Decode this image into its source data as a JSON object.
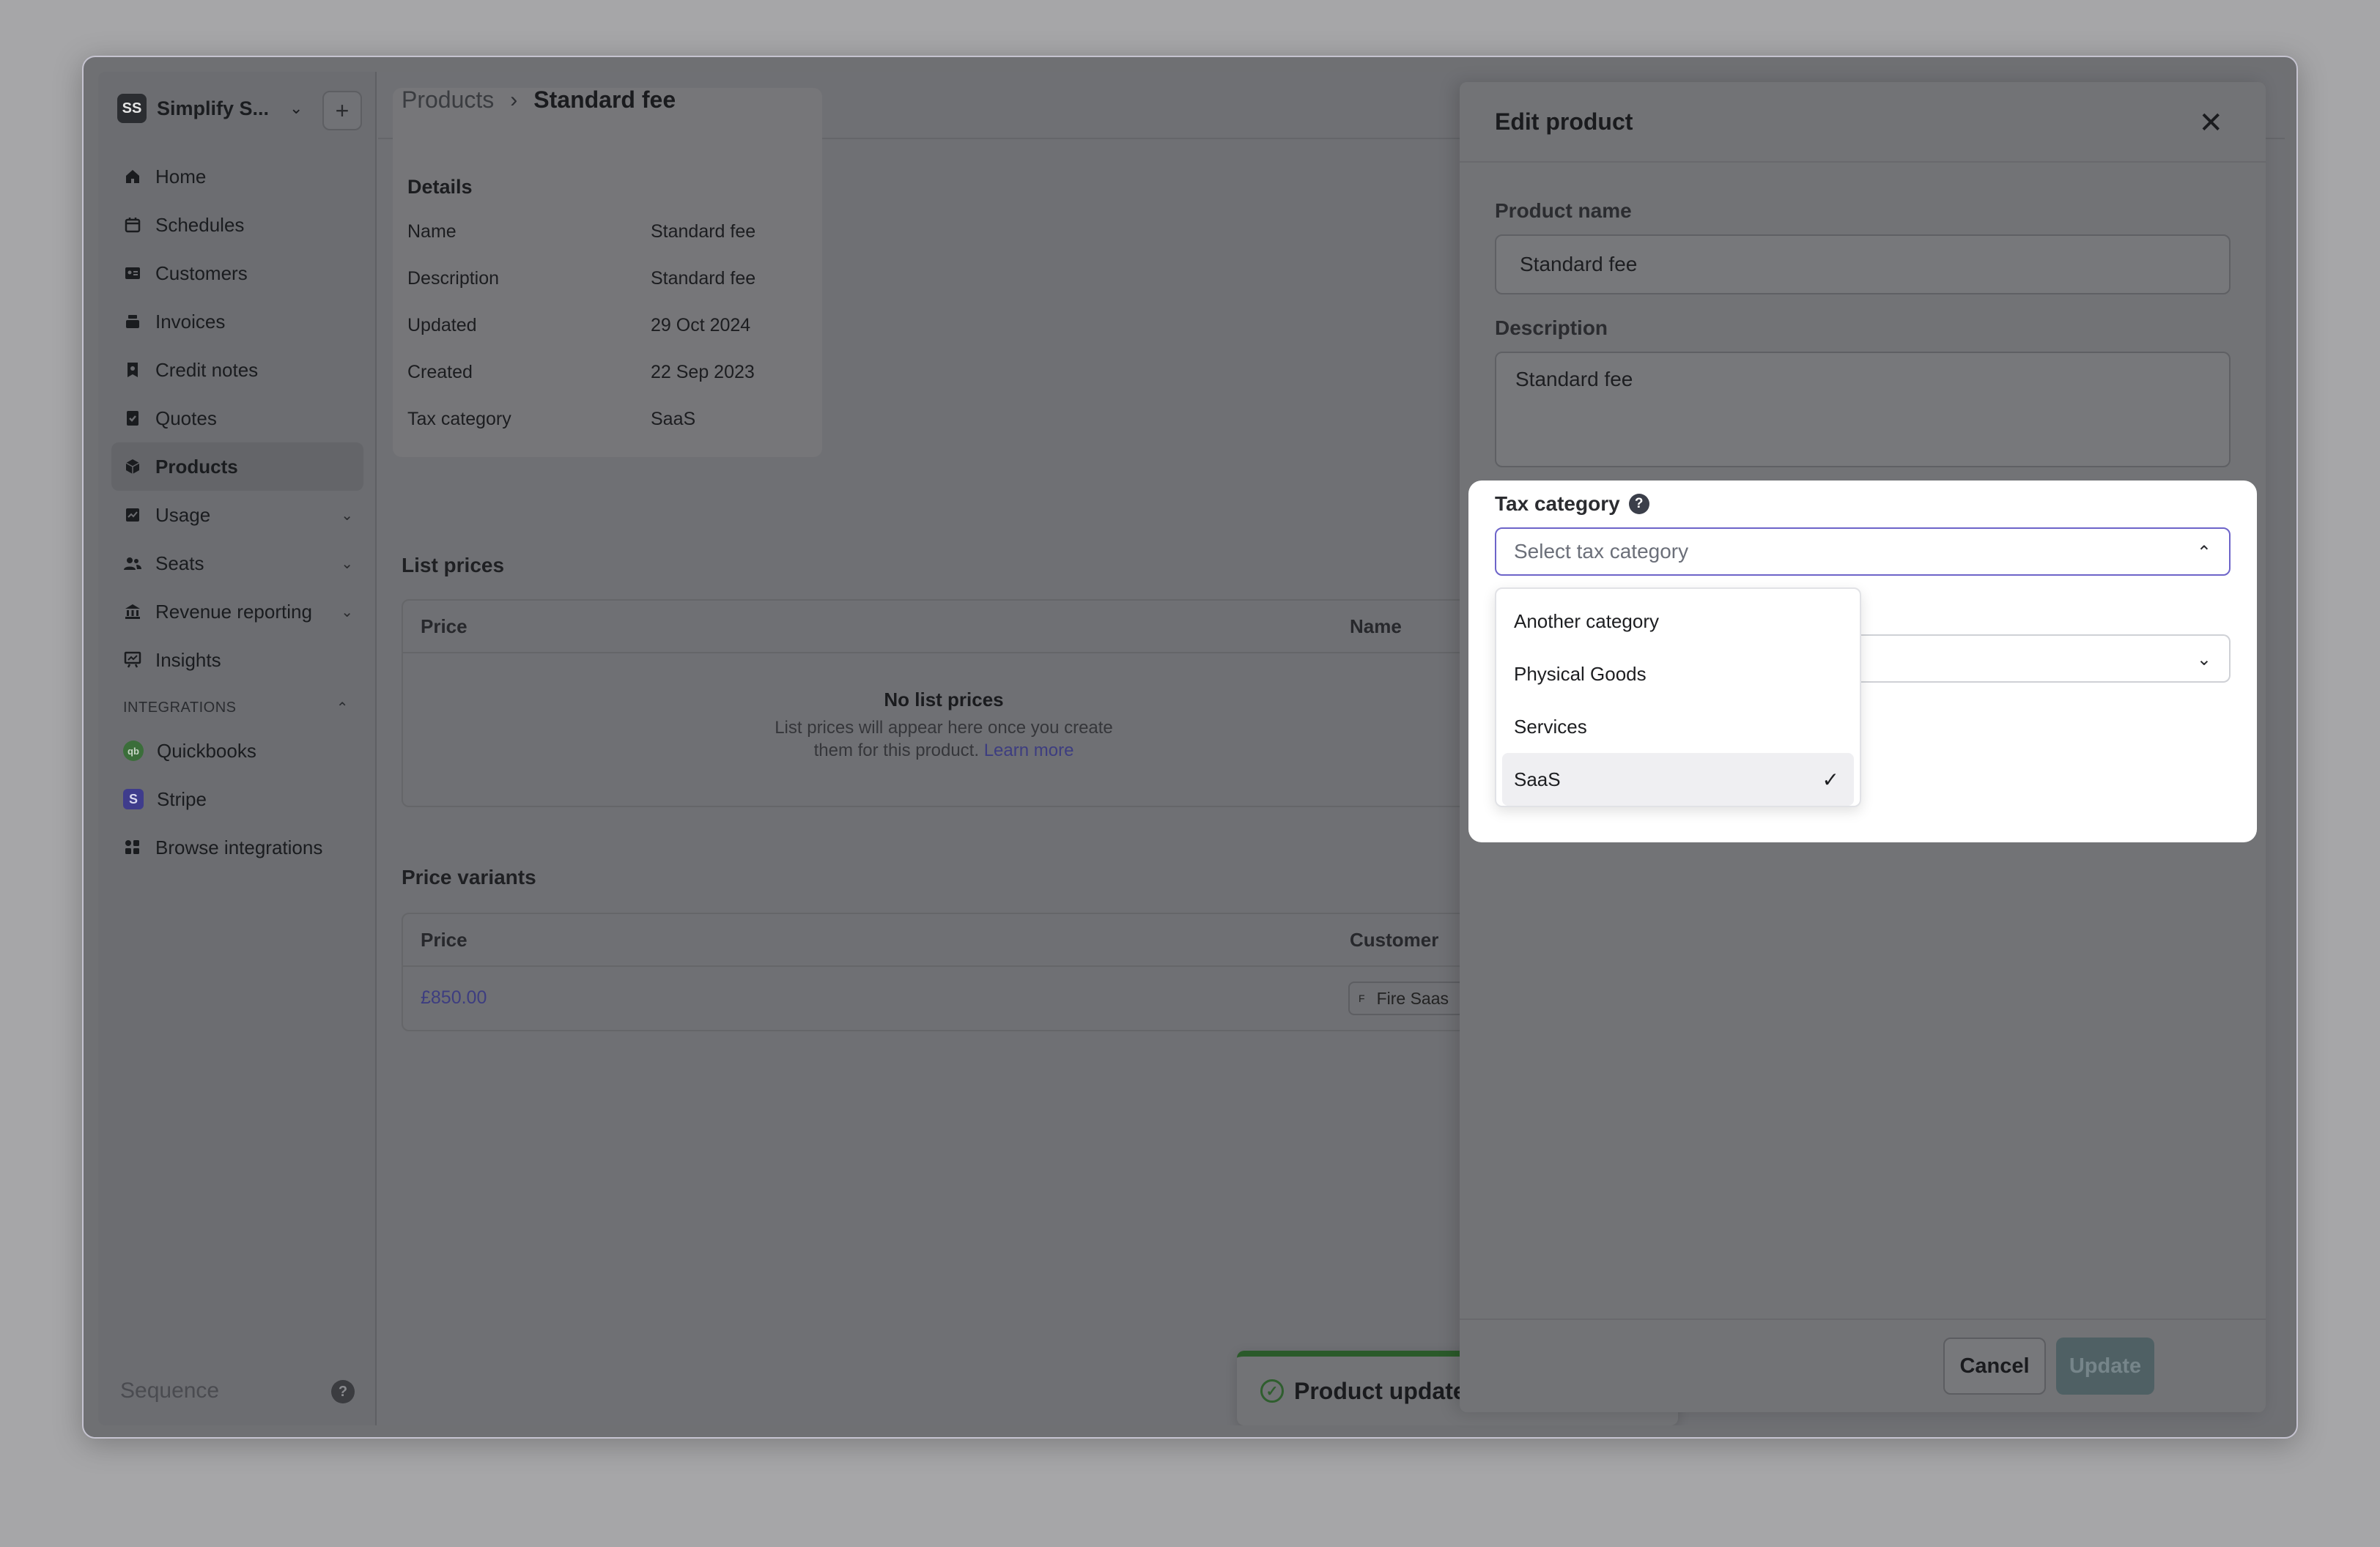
{
  "org": {
    "badge": "SS",
    "name": "Simplify S..."
  },
  "sidebar": {
    "items": [
      {
        "label": "Home",
        "icon": "home-icon"
      },
      {
        "label": "Schedules",
        "icon": "calendar-icon"
      },
      {
        "label": "Customers",
        "icon": "id-card-icon"
      },
      {
        "label": "Invoices",
        "icon": "stack-icon"
      },
      {
        "label": "Credit notes",
        "icon": "credit-note-icon"
      },
      {
        "label": "Quotes",
        "icon": "quote-icon"
      },
      {
        "label": "Products",
        "icon": "cube-icon"
      },
      {
        "label": "Usage",
        "icon": "usage-icon"
      },
      {
        "label": "Seats",
        "icon": "users-icon"
      },
      {
        "label": "Revenue reporting",
        "icon": "bank-icon"
      },
      {
        "label": "Insights",
        "icon": "chart-icon"
      }
    ],
    "integrations_label": "INTEGRATIONS",
    "integrations": [
      {
        "label": "Quickbooks",
        "badge": "qb"
      },
      {
        "label": "Stripe",
        "badge": "S"
      },
      {
        "label": "Browse integrations"
      }
    ],
    "brand": "Sequence",
    "help": "?"
  },
  "breadcrumb": {
    "parent": "Products",
    "current": "Standard fee"
  },
  "details": {
    "title": "Details",
    "rows": [
      {
        "k": "Name",
        "v": "Standard fee"
      },
      {
        "k": "Description",
        "v": "Standard fee"
      },
      {
        "k": "Updated",
        "v": "29 Oct 2024"
      },
      {
        "k": "Created",
        "v": "22 Sep 2023"
      },
      {
        "k": "Tax category",
        "v": "SaaS"
      }
    ]
  },
  "list_prices": {
    "title": "List prices",
    "col_price": "Price",
    "col_name": "Name",
    "empty_title": "No list prices",
    "empty_desc_1": "List prices will appear here once you create",
    "empty_desc_2": "them for this product.",
    "learn_more": "Learn more"
  },
  "price_variants": {
    "title": "Price variants",
    "col_price": "Price",
    "col_customer": "Customer",
    "row_price": "£850.00",
    "row_customer_initial": "F",
    "row_customer": "Fire Saas"
  },
  "toast": {
    "text": "Product updated"
  },
  "drawer": {
    "title": "Edit product",
    "product_name_label": "Product name",
    "product_name_value": "Standard fee",
    "description_label": "Description",
    "description_value": "Standard fee",
    "tax_label": "Tax category",
    "tax_placeholder": "Select tax category",
    "tax_options": [
      "Another category",
      "Physical Goods",
      "Services",
      "SaaS"
    ],
    "selected_option": "SaaS",
    "cancel": "Cancel",
    "update": "Update"
  },
  "colors": {
    "accent": "#6d64c9",
    "toast_bar": "#2b5a2a",
    "link": "#3d3d80"
  }
}
